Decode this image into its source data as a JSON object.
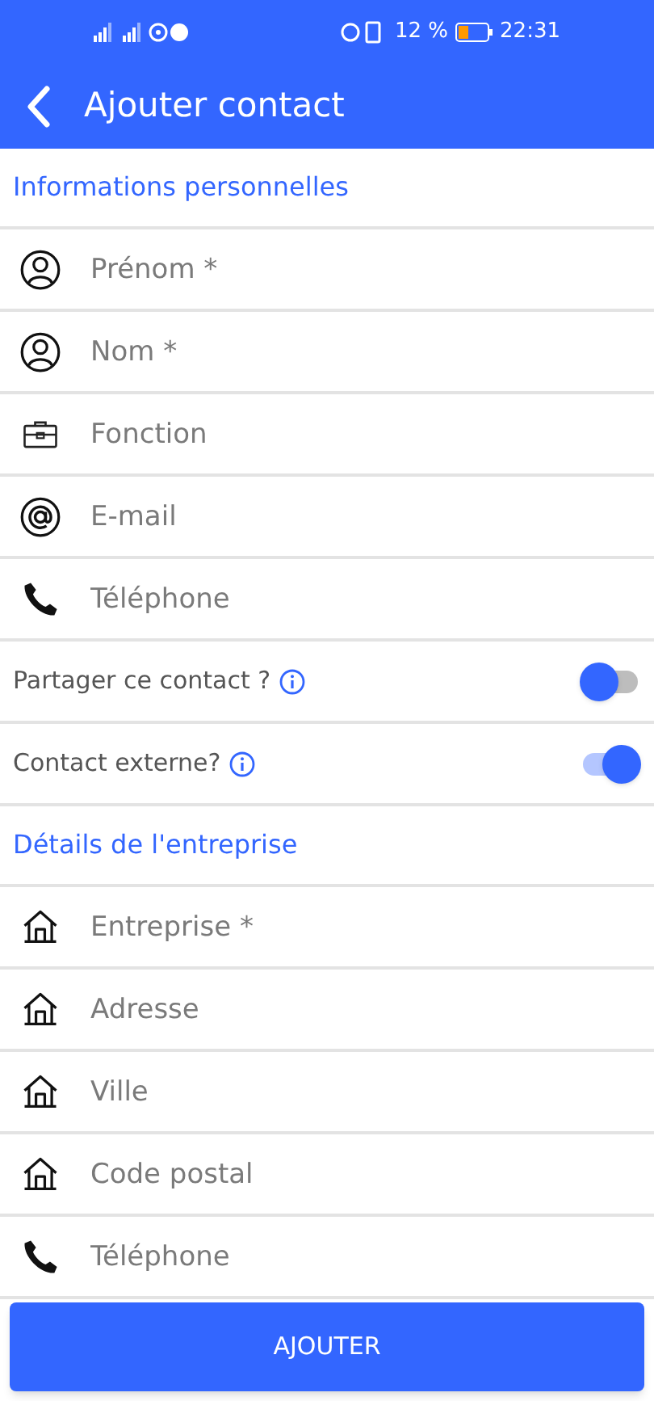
{
  "status_bar": {
    "battery": "12 %",
    "time": "22:31"
  },
  "header": {
    "title": "Ajouter contact"
  },
  "sections": [
    {
      "title": "Informations personnelles",
      "rows": [
        {
          "kind": "name",
          "placeholder": "Prénom *"
        },
        {
          "kind": "name",
          "placeholder": "Nom *"
        },
        {
          "kind": "job",
          "placeholder": "Fonction"
        },
        {
          "kind": "email",
          "placeholder": "E-mail"
        },
        {
          "kind": "phone",
          "placeholder": "Téléphone"
        },
        {
          "kind": "toggle",
          "label": "Partager ce contact ?",
          "on": false
        },
        {
          "kind": "toggle",
          "label": "Contact externe?",
          "on": true
        }
      ]
    },
    {
      "title": "Détails de l'entreprise",
      "rows": [
        {
          "kind": "address",
          "placeholder": "Entreprise *"
        },
        {
          "kind": "address",
          "placeholder": "Adresse"
        },
        {
          "kind": "address",
          "placeholder": "Ville"
        },
        {
          "kind": "address",
          "placeholder": "Code postal"
        },
        {
          "kind": "phone",
          "placeholder": "Téléphone"
        }
      ]
    }
  ],
  "submit": {
    "label": "AJOUTER"
  }
}
